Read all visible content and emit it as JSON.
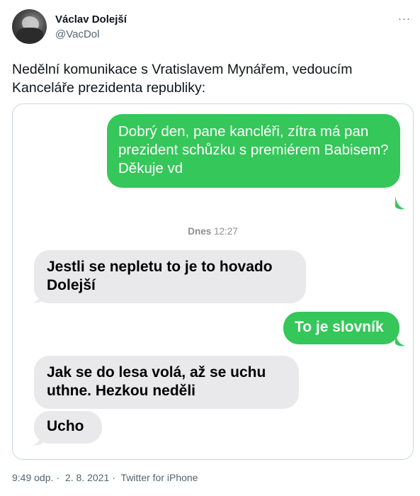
{
  "author": {
    "name": "Václav Dolejší",
    "handle": "@VacDol"
  },
  "more_label": "···",
  "tweet": {
    "text": "Nedělní komunikace s Vratislavem Mynářem, vedoucím Kanceláře prezidenta republiky:"
  },
  "chat": {
    "messages": [
      {
        "side": "out",
        "text": "Dobrý den, pane kancléři, zítra má pan prezident schůzku s premiérem Babisem?\nDěkuje vd"
      },
      {
        "side": "in",
        "text": "Jestli se nepletu to je to hovado Dolejší"
      },
      {
        "side": "out",
        "text": "To je slovník"
      },
      {
        "side": "in",
        "text": "Jak se do lesa volá, až se uchu uthne. Hezkou neděli"
      },
      {
        "side": "in",
        "text": "Ucho"
      }
    ],
    "timestamp_day": "Dnes",
    "timestamp_time": "12:27"
  },
  "footer": {
    "time": "9:49 odp.",
    "date": "2. 8. 2021",
    "source": "Twitter for iPhone",
    "sep": "·"
  },
  "colors": {
    "outgoing_bubble": "#35c759",
    "incoming_bubble": "#e9e9eb"
  }
}
